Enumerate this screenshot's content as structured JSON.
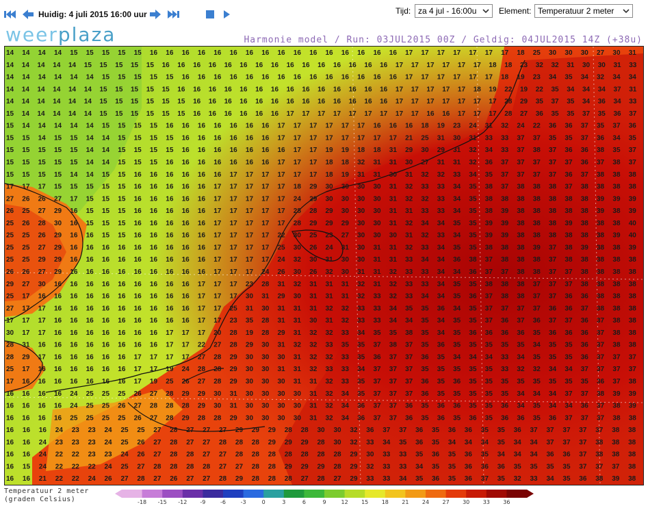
{
  "toolbar": {
    "prev_start_icon": "skip-back-icon",
    "prev_icon": "arrow-left-icon",
    "current_label": "Huidig: 4 juli 2015 16:00 uur",
    "next_icon": "arrow-right-icon",
    "next_end_icon": "skip-forward-icon",
    "stop_icon": "stop-icon",
    "play_icon": "play-icon",
    "tijd_label": "Tijd:",
    "tijd_value": "za 4 jul - 16:00u",
    "element_label": "Element:",
    "element_value": "Temperatuur 2 meter"
  },
  "header": {
    "logo_part1": "weer",
    "logo_part2": "plaza",
    "model_run": "Harmonie model / Run: 03JUL2015 00Z / Geldig: 04JUL2015 14Z (+38u)"
  },
  "legend": {
    "title_line1": "Temperatuur 2 meter",
    "title_line2": "(graden Celsius)",
    "ticks": [
      "-18",
      "-15",
      "-12",
      "-9",
      "-6",
      "-3",
      "0",
      "3",
      "6",
      "9",
      "12",
      "15",
      "18",
      "21",
      "24",
      "27",
      "30",
      "33",
      "36"
    ],
    "colors": [
      "#e6b3e6",
      "#c77dd8",
      "#9c4fc2",
      "#6a2fa8",
      "#3b2b9e",
      "#1f3fbf",
      "#2a6ae0",
      "#2aa0a0",
      "#1f9a3c",
      "#3db83a",
      "#7ccc2e",
      "#b6dc28",
      "#e6e82a",
      "#f2c41e",
      "#f29a16",
      "#ef6a10",
      "#e43a0a",
      "#c81a06",
      "#a00a04",
      "#7a0404"
    ]
  },
  "map": {
    "temperature_rows": [
      "14 14 14 14 15 15 15 15 15 16 16 16 16 16 16 16 16 16 16 16 16 16 16 16 16 17 17 17 17 17 17 17 18 25 30 30 30 27 30 31",
      "14 14 14 14 14 15 15 15 15 15 16 16 16 16 16 16 16 16 16 16 16 16 16 16 16 17 17 17 17 17 17 18 18 23 32 32 31 30 30 31 33",
      "14 14 14 14 14 14 15 15 15 15 15 16 16 16 16 16 16 16 16 16 16 16 16 16 16 17 17 17 17 17 17 18 19 23 34 35 34 32 34 34",
      "14 14 14 14 14 14 15 15 15 15 15 16 16 16 16 16 16 16 16 16 16 16 16 16 16 17 17 17 17 17 18 19 22 19 22 35 34 34 34 37 31",
      "14 14 14 14 14 14 15 15 15 15 15 15 16 16 16 16 16 16 16 16 16 16 16 16 16 17 17 17 17 17 17 17 28 29 35 37 35 34 36 34 33",
      "15 14 14 14 14 14 15 15 15 15 15 15 16 16 16 16 16 16 17 17 17 17 17 17 17 17 17 16 16 17 17 17 28 27 36 35 35 37 35 36 37",
      "15 14 14 14 14 14 15 15 15 15 16 16 16 16 16 16 16 17 17 17 17 17 17 16 16 16 18 19 23 24 31 32 24 22 36 36 37 35 37 36",
      "15 15 14 15 15 14 14 15 15 15 15 16 16 16 16 16 16 17 17 17 17 17 17 17 17 21 25 31 30 31 33 33 37 37 35 35 37 36 34 35",
      "15 15 15 15 15 14 14 15 15 15 15 16 16 16 16 16 16 16 17 17 19 19 18 18 31 29 30 29 31 32 34 33 37 38 37 36 36 38 35 37",
      "15 15 15 15 15 14 14 15 15 15 16 16 16 16 16 16 16 17 17 17 18 18 32 31 31 30 27 31 31 32 36 37 37 37 37 37 36 37 38 37",
      "15 15 15 15 14 14 15 15 16 16 16 16 16 16 17 17 17 17 17 17 18 19 31 31 30 31 32 32 33 34 35 37 37 37 37 36 37 38 38 38",
      "17 17 17 15 15 15 15 15 16 16 16 16 16 17 17 17 17 17 18 29 30 30 30 30 31 32 33 33 34 35 38 37 38 38 38 37 38 38 38 38",
      "27 26 26 27 17 15 15 15 16 16 16 16 16 17 17 17 17 17 24 29 30 30 30 30 31 32 32 33 34 35 38 38 38 38 38 38 38 39 39 39",
      "26 25 27 29 16 15 15 15 16 16 16 16 16 17 17 17 17 17 28 28 29 30 30 30 31 31 33 33 34 35 38 39 38 38 38 38 38 39 38 39",
      "25 26 28 30 16 15 15 15 16 16 16 16 16 17 17 17 17 17 28 29 29 29 30 30 31 32 34 34 35 35 39 39 38 38 38 39 38 38 38 40",
      "25 25 26 29 16 16 15 15 16 16 16 16 16 17 17 17 17 22 30 25 23 27 30 30 30 31 32 33 34 35 39 39 38 38 38 38 38 38 39 40",
      "25 25 27 29 16 16 16 16 16 16 16 16 16 17 17 17 17 25 30 26 24 31 30 31 31 32 33 34 35 35 38 38 38 39 37 38 39 38 38 39",
      "25 25 29 29 16 16 16 16 16 16 16 16 16 17 17 17 17 24 32 30 31 30 30 31 31 33 34 34 36 38 37 38 38 38 37 38 38 38 38 38",
      "26 26 27 29 16 16 16 16 16 16 16 16 16 17 17 17 24 26 30 26 32 30 31 31 32 33 33 34 34 36 37 37 38 38 37 37 38 38 38 38",
      "29 27 30 16 16 16 16 16 16 16 16 16 17 17 17 23 28 31 32 31 31 31 32 31 32 33 33 34 35 35 38 38 38 37 37 37 38 38 38 38",
      "25 17 16 16 16 16 16 16 16 16 16 16 17 17 17 30 31 29 30 31 31 31 32 33 32 33 34 34 35 36 37 38 38 37 37 36 36 38 38 38",
      "27 17 17 16 16 16 16 16 16 16 16 16 17 17 25 31 30 31 31 31 32 32 33 33 34 35 35 36 34 35 37 37 37 37 36 36 37 38 38 38",
      "17 17 17 16 16 16 16 16 16 16 16 16 17 17 23 35 28 31 31 30 31 32 33 33 34 34 35 34 35 35 37 36 37 36 37 37 36 37 38 38",
      "30 17 17 16 16 16 16 16 16 16 17 17 17 20 28 19 28 29 31 32 32 33 34 35 35 38 35 34 35 36 36 36 36 35 36 36 36 37 38 38",
      "28 31 16 16 16 16 16 16 16 16 17 17 22 27 28 29 30 31 32 32 33 35 35 37 38 37 35 36 35 35 35 35 35 34 35 35 36 37 38 38",
      "28 29 17 16 16 16 16 16 17 17 17 17 27 28 29 30 30 30 31 32 32 33 35 36 37 37 36 35 34 34 34 33 34 35 35 35 36 37 37 37",
      "25 17 16 16 16 16 16 16 17 17 19 24 28 28 29 30 30 31 31 32 33 33 34 37 37 37 35 35 35 35 35 33 32 32 34 34 37 37 37 37",
      "17 16 16 16 16 16 16 16 17 19 25 26 27 28 29 30 30 30 31 31 32 33 35 37 37 37 36 35 36 35 35 35 35 35 35 35 35 36 37 38",
      "16 16 16 16 24 25 25 25 26 27 28 29 29 30 31 30 30 30 30 31 32 34 35 37 37 37 36 35 35 35 35 35 34 34 34 37 37 38 39 39",
      "16 16 16 16 24 25 25 26 27 28 28 28 29 30 31 30 30 30 30 31 32 34 36 37 37 36 35 36 36 35 35 36 34 35 34 34 36 37 38 39",
      "16 16 16 16 25 25 25 25 26 27 28 29 28 28 29 30 30 30 30 31 32 34 36 37 37 36 35 36 35 36 35 36 36 35 36 37 37 37 38 38",
      "16 16 16 24 23 23 24 25 25 27 28 27 27 27 29 29 29 28 28 30 30 32 36 37 37 36 35 36 36 35 35 36 37 37 37 37 37 38 38",
      "16 16 24 23 23 23 24 25 26 27 28 27 27 28 28 28 29 29 29 28 30 32 33 34 35 36 35 34 34 34 35 34 34 37 37 37 38 38 38",
      "16 16 24 22 22 23 23 24 26 27 28 28 27 27 28 28 28 28 28 28 28 29 30 33 33 35 36 35 36 35 34 34 34 36 36 37 38 38 38",
      "16 15 24 22 22 22 24 25 27 28 28 28 28 27 27 28 28 29 29 29 28 29 32 33 33 34 35 35 36 36 36 35 35 35 35 37 37 37 38",
      "16 16 21 22 22 24 26 27 28 27 26 27 27 28 29 28 28 28 27 28 27 29 33 33 34 35 36 35 36 37 35 32 33 34 35 36 38 39 38"
    ]
  }
}
